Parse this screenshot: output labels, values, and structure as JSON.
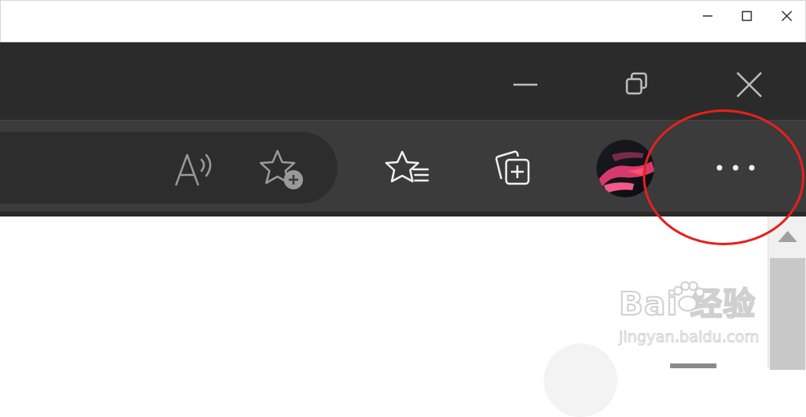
{
  "outer_window": {
    "minimize_icon": "minimize-icon",
    "maximize_icon": "maximize-icon",
    "close_icon": "close-icon"
  },
  "browser_titlebar": {
    "minimize_icon": "minimize-icon",
    "restore_icon": "restore-icon",
    "close_icon": "close-icon"
  },
  "toolbar": {
    "read_aloud_icon": "read-aloud-icon",
    "add_favorite_icon": "add-favorite-icon",
    "favorites_icon": "favorites-icon",
    "collections_icon": "collections-icon",
    "profile_icon": "profile-avatar",
    "more_menu_label": "•••"
  },
  "annotation": {
    "color": "#e5211d"
  },
  "watermark": {
    "main": "Bai  经验",
    "sub": "jingyan.baidu.com"
  },
  "colors": {
    "titlebar_bg": "#2b2b2b",
    "toolbar_bg": "#3b3b3b",
    "address_bg": "#2d2d2d"
  }
}
